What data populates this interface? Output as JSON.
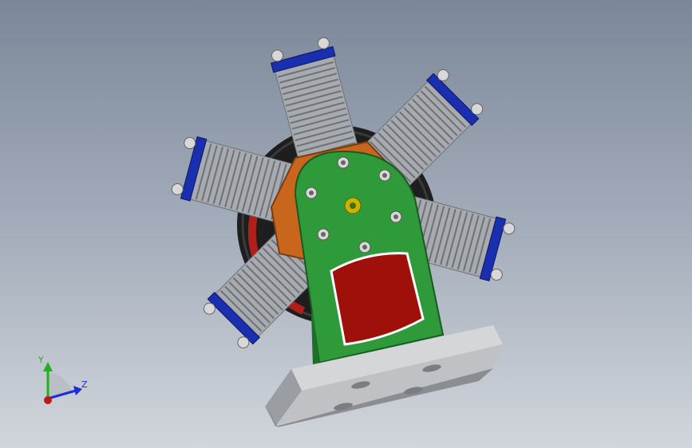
{
  "viewport": {
    "background_top": "#7b8799",
    "background_bottom": "#d2d6dc"
  },
  "model": {
    "cylinder_count": 6,
    "colors": {
      "fins": "#a7abb0",
      "fin_dark": "#6d7176",
      "cylinder_cap": "#1a2fb0",
      "crankcase_orange": "#c8661e",
      "frame_green": "#2f9a3a",
      "window_red": "#a0100a",
      "flywheel": "#1e1e1e",
      "flywheel_rim_red": "#b0201a",
      "base_plate": "#bfc1c4",
      "base_plate_dark": "#8a8d91",
      "bolt": "#d8d8d8",
      "shaft": "#c8b400"
    }
  },
  "triad": {
    "y_label": "Y",
    "z_label": "Z",
    "y_color": "#1db31d",
    "z_color": "#1a2fd8",
    "x_color": "#c01818"
  }
}
